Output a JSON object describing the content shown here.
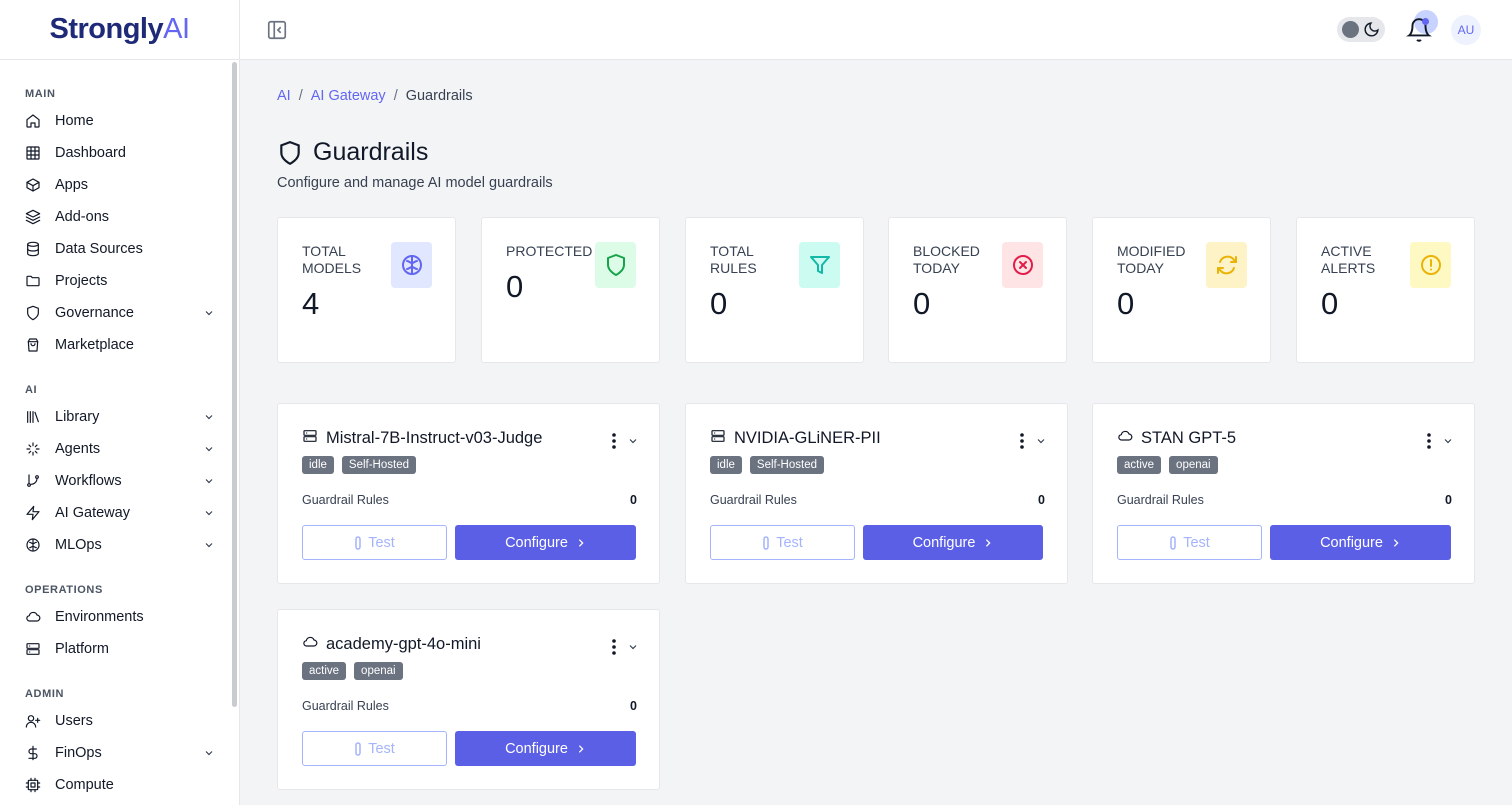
{
  "app": {
    "logo_main": "Strongly",
    "logo_ai": "AI",
    "user_initials": "AU"
  },
  "sidebar": {
    "sections": [
      {
        "title": "MAIN",
        "items": [
          {
            "label": "Home",
            "icon": "home-icon"
          },
          {
            "label": "Dashboard",
            "icon": "grid-icon"
          },
          {
            "label": "Apps",
            "icon": "box-icon"
          },
          {
            "label": "Add-ons",
            "icon": "layers-icon"
          },
          {
            "label": "Data Sources",
            "icon": "database-icon"
          },
          {
            "label": "Projects",
            "icon": "folder-icon"
          },
          {
            "label": "Governance",
            "icon": "shield-icon",
            "expandable": true
          },
          {
            "label": "Marketplace",
            "icon": "shopping-bag-icon"
          }
        ]
      },
      {
        "title": "AI",
        "items": [
          {
            "label": "Library",
            "icon": "library-icon",
            "expandable": true
          },
          {
            "label": "Agents",
            "icon": "sparkles-icon",
            "expandable": true
          },
          {
            "label": "Workflows",
            "icon": "git-branch-icon",
            "expandable": true
          },
          {
            "label": "AI Gateway",
            "icon": "zap-icon",
            "expandable": true
          },
          {
            "label": "MLOps",
            "icon": "brain-icon",
            "expandable": true
          }
        ]
      },
      {
        "title": "OPERATIONS",
        "items": [
          {
            "label": "Environments",
            "icon": "cloud-icon"
          },
          {
            "label": "Platform",
            "icon": "server-icon"
          }
        ]
      },
      {
        "title": "ADMIN",
        "items": [
          {
            "label": "Users",
            "icon": "user-plus-icon"
          },
          {
            "label": "FinOps",
            "icon": "dollar-icon",
            "expandable": true
          },
          {
            "label": "Compute",
            "icon": "cpu-icon"
          }
        ]
      }
    ]
  },
  "breadcrumb": {
    "items": [
      "AI",
      "AI Gateway"
    ],
    "current": "Guardrails",
    "separator": "/"
  },
  "page": {
    "title": "Guardrails",
    "subtitle": "Configure and manage AI model guardrails"
  },
  "stats": [
    {
      "label": "Total Models",
      "value": "4",
      "icon": "brain-icon",
      "color": "#6366f1",
      "bg": "#e0e7ff"
    },
    {
      "label": "Protected",
      "value": "0",
      "icon": "shield-icon",
      "color": "#16a34a",
      "bg": "#dcfce7"
    },
    {
      "label": "Total Rules",
      "value": "0",
      "icon": "filter-icon",
      "color": "#14b8a6",
      "bg": "#ccfbf1"
    },
    {
      "label": "Blocked Today",
      "value": "0",
      "icon": "x-circle-icon",
      "color": "#e11d48",
      "bg": "#ffe4e6"
    },
    {
      "label": "Modified Today",
      "value": "0",
      "icon": "refresh-icon",
      "color": "#eab308",
      "bg": "#fef3c7"
    },
    {
      "label": "Active Alerts",
      "value": "0",
      "icon": "alert-circle-icon",
      "color": "#eab308",
      "bg": "#fef9c3"
    }
  ],
  "models": [
    {
      "name": "Mistral-7B-Instruct-v03-Judge",
      "icon": "server-icon",
      "status": "idle",
      "type": "Self-Hosted",
      "rules_label": "Guardrail Rules",
      "rules": "0",
      "test_label": "Test",
      "configure_label": "Configure"
    },
    {
      "name": "NVIDIA-GLiNER-PII",
      "icon": "server-icon",
      "status": "idle",
      "type": "Self-Hosted",
      "rules_label": "Guardrail Rules",
      "rules": "0",
      "test_label": "Test",
      "configure_label": "Configure"
    },
    {
      "name": "STAN GPT-5",
      "icon": "cloud-icon",
      "status": "active",
      "type": "openai",
      "rules_label": "Guardrail Rules",
      "rules": "0",
      "test_label": "Test",
      "configure_label": "Configure"
    },
    {
      "name": "academy-gpt-4o-mini",
      "icon": "cloud-icon",
      "status": "active",
      "type": "openai",
      "rules_label": "Guardrail Rules",
      "rules": "0",
      "test_label": "Test",
      "configure_label": "Configure"
    }
  ],
  "theme": {
    "accent": "#5b5fe6",
    "badge": "#6b7280"
  }
}
